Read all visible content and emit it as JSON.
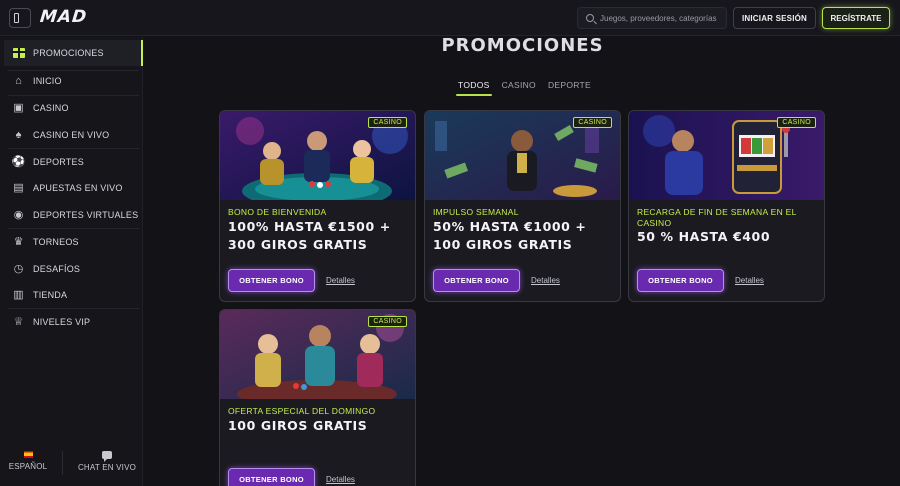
{
  "header": {
    "logo": "MAD",
    "search_placeholder": "Juegos, proveedores, categorías",
    "login_label": "INICIAR SESIÓN",
    "register_label": "REGÍSTRATE"
  },
  "sidebar": {
    "active": {
      "label": "PROMOCIONES",
      "icon": "gift-icon"
    },
    "items": [
      {
        "label": "INICIO",
        "icon": "home-icon"
      },
      {
        "label": "CASINO",
        "icon": "slot-machine-icon"
      },
      {
        "label": "CASINO EN VIVO",
        "icon": "cards-icon"
      },
      {
        "label": "DEPORTES",
        "icon": "soccer-ball-icon"
      },
      {
        "label": "APUESTAS EN VIVO",
        "icon": "live-tv-icon"
      },
      {
        "label": "DEPORTES VIRTUALES",
        "icon": "gamepad-icon"
      },
      {
        "label": "TORNEOS",
        "icon": "trophy-icon"
      },
      {
        "label": "DESAFÍOS",
        "icon": "stopwatch-icon"
      },
      {
        "label": "TIENDA",
        "icon": "shopping-bag-icon"
      },
      {
        "label": "NIVELES VIP",
        "icon": "crown-icon"
      }
    ],
    "footer": {
      "language": "ESPAÑOL",
      "chat": "CHAT EN VIVO"
    }
  },
  "main": {
    "title": "PROMOCIONES",
    "tabs": [
      {
        "label": "TODOS",
        "active": true
      },
      {
        "label": "CASINO",
        "active": false
      },
      {
        "label": "DEPORTE",
        "active": false
      }
    ],
    "cards": [
      {
        "badge": "CASINO",
        "subtitle": "BONO DE BIENVENIDA",
        "headline": "100% HASTA €1500 + 300 GIROS GRATIS",
        "button": "OBTENER BONO",
        "link": "Detalles"
      },
      {
        "badge": "CASINO",
        "subtitle": "IMPULSO SEMANAL",
        "headline": "50% HASTA €1000 + 100 GIROS GRATIS",
        "button": "OBTENER BONO",
        "link": "Detalles"
      },
      {
        "badge": "CASINO",
        "subtitle": "RECARGA DE FIN DE SEMANA EN EL CASINO",
        "headline": "50 % HASTA €400",
        "button": "OBTENER BONO",
        "link": "Detalles"
      },
      {
        "badge": "CASINO",
        "subtitle": "OFERTA ESPECIAL DEL DOMINGO",
        "headline": "100 GIROS GRATIS",
        "button": "OBTENER BONO",
        "link": "Detalles"
      }
    ]
  },
  "colors": {
    "accent": "#c6ef4e",
    "button_purple": "#6a2ab0",
    "background": "#121217"
  }
}
